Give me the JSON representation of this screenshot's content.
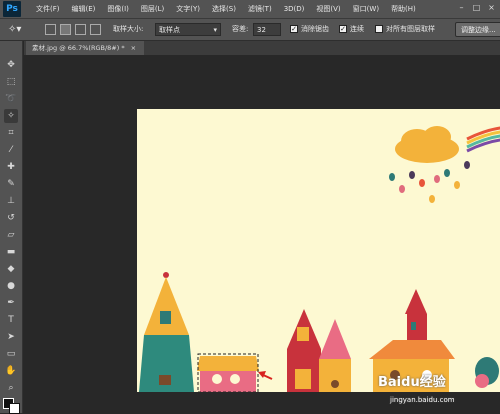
{
  "app": {
    "logo": "Ps"
  },
  "menu": [
    "文件(F)",
    "编辑(E)",
    "图像(I)",
    "图层(L)",
    "文字(Y)",
    "选择(S)",
    "滤镜(T)",
    "3D(D)",
    "视图(V)",
    "窗口(W)",
    "帮助(H)"
  ],
  "options": {
    "sample_size_label": "取样大小:",
    "sample_size_value": "取样点",
    "tolerance_label": "容差:",
    "tolerance_value": "32",
    "antialias_label": "消除锯齿",
    "contiguous_label": "连续",
    "all_layers_label": "对所有图层取样",
    "refine_edge_button": "调整边缘..."
  },
  "document": {
    "tab_title": "素材.jpg @ 66.7%(RGB/8#) *"
  },
  "tools": [
    "move-tool-icon",
    "marquee-tool-icon",
    "lasso-tool-icon",
    "magic-wand-tool-icon",
    "crop-tool-icon",
    "eyedropper-tool-icon",
    "healing-brush-icon",
    "brush-tool-icon",
    "clone-stamp-icon",
    "history-brush-icon",
    "eraser-tool-icon",
    "gradient-tool-icon",
    "blur-tool-icon",
    "dodge-tool-icon",
    "pen-tool-icon",
    "type-tool-icon",
    "path-selection-icon",
    "rectangle-tool-icon",
    "hand-tool-icon",
    "zoom-tool-icon"
  ],
  "colors": {
    "canvas_bg": "#fdf9d2",
    "ui_dark": "#535353",
    "workspace": "#282828"
  },
  "watermark": {
    "brand": "Baidu经验",
    "url": "jingyan.baidu.com"
  }
}
